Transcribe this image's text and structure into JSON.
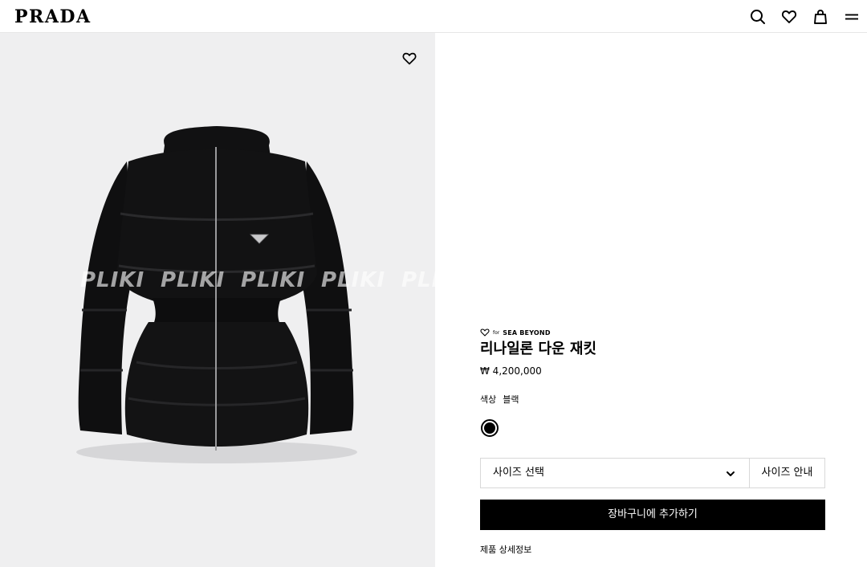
{
  "header": {
    "logo": "PRADA",
    "icons": [
      "search-icon",
      "heart-icon",
      "bag-icon",
      "menu-icon"
    ]
  },
  "image": {
    "watermark": [
      "PLIKI",
      "PLIKI",
      "PLIKI",
      "PLIKI",
      "PLIKI"
    ],
    "background_color": "#efeff0"
  },
  "product": {
    "brand_tag_for": "for",
    "brand_tag_name": "SEA BEYOND",
    "title": "리나일론 다운 재킷",
    "price": "₩ 4,200,000",
    "color_label": "색상",
    "color_value": "블랙",
    "swatch_color": "#000000",
    "size_select_label": "사이즈 선택",
    "size_guide_label": "사이즈 안내",
    "add_to_cart_label": "장바구니에 추가하기",
    "details_link_label": "제품 상세정보"
  }
}
